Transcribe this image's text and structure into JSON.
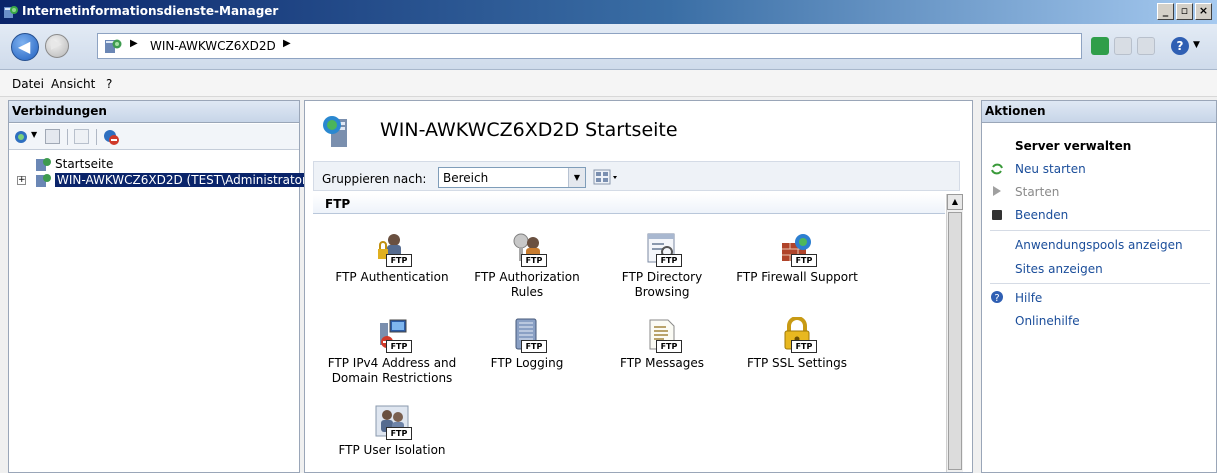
{
  "window": {
    "title": "Internetinformationsdienste-Manager",
    "controls": [
      "_",
      "̅",
      "×"
    ]
  },
  "address": {
    "crumbs": [
      "WIN-AWKWCZ6XD2D"
    ]
  },
  "menu": [
    "Datei",
    "Ansicht",
    "?"
  ],
  "connections": {
    "header": "Verbindungen",
    "tree": [
      {
        "label": "Startseite",
        "selected": false
      },
      {
        "label": "WIN-AWKWCZ6XD2D (TEST\\Administrator",
        "selected": true,
        "expander": "+"
      }
    ]
  },
  "center": {
    "title": "WIN-AWKWCZ6XD2D Startseite",
    "group_label": "Gruppieren nach:",
    "group_value": "Bereich",
    "section": "FTP",
    "features": [
      {
        "label": "FTP Authentication",
        "icon": "ftp-authentication-icon"
      },
      {
        "label": "FTP Authorization Rules",
        "icon": "ftp-authorization-rules-icon"
      },
      {
        "label": "FTP Directory Browsing",
        "icon": "ftp-directory-browsing-icon"
      },
      {
        "label": "FTP Firewall Support",
        "icon": "ftp-firewall-support-icon"
      },
      {
        "label": "FTP IPv4 Address and Domain Restrictions",
        "icon": "ftp-ipv4-restrictions-icon"
      },
      {
        "label": "FTP Logging",
        "icon": "ftp-logging-icon"
      },
      {
        "label": "FTP Messages",
        "icon": "ftp-messages-icon"
      },
      {
        "label": "FTP SSL Settings",
        "icon": "ftp-ssl-settings-icon"
      },
      {
        "label": "FTP User Isolation",
        "icon": "ftp-user-isolation-icon"
      }
    ],
    "badge": "FTP"
  },
  "actions": {
    "header": "Aktionen",
    "group_title": "Server verwalten",
    "restart": "Neu starten",
    "start": "Starten",
    "stop": "Beenden",
    "app_pools": "Anwendungspools anzeigen",
    "sites": "Sites anzeigen",
    "help": "Hilfe",
    "online_help": "Onlinehilfe"
  }
}
